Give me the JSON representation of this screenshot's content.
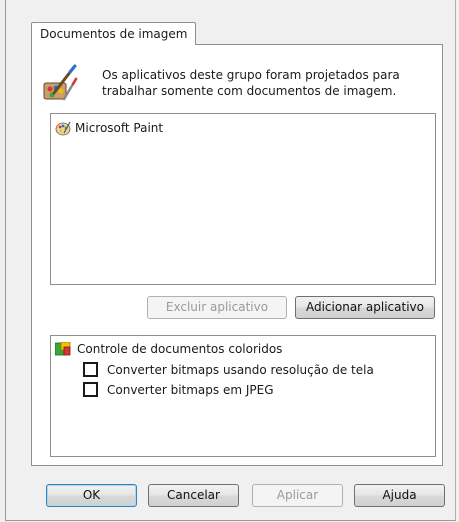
{
  "tab": {
    "label": "Documentos de imagem"
  },
  "description": {
    "text": "Os aplicativos deste grupo foram projetados para trabalhar somente com documentos de imagem."
  },
  "applications": {
    "items": [
      {
        "label": "Microsoft Paint",
        "icon": "paint-palette-icon"
      }
    ]
  },
  "app_buttons": {
    "remove_label": "Excluir aplicativo",
    "add_label": "Adicionar aplicativo"
  },
  "options": {
    "title": "Controle de documentos coloridos",
    "checkboxes": [
      {
        "label": "Converter bitmaps usando resolução de tela",
        "checked": false
      },
      {
        "label": "Converter bitmaps em JPEG",
        "checked": false
      }
    ]
  },
  "dialog_buttons": {
    "ok": "OK",
    "cancel": "Cancelar",
    "apply": "Aplicar",
    "help": "Ajuda"
  }
}
